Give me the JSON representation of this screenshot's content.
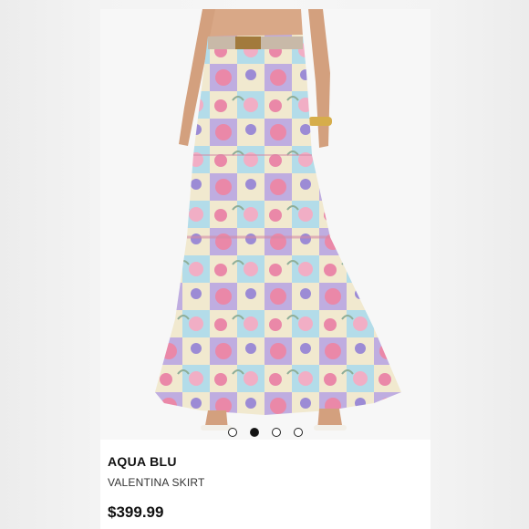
{
  "product": {
    "brand": "AQUA BLU",
    "name": "VALENTINA SKIRT",
    "price": "$399.99"
  },
  "carousel": {
    "total": 4,
    "active_index": 1
  },
  "colors": {
    "price": "#111111",
    "pink": "#e8789c",
    "lilac": "#b7a2dc",
    "aqua": "#a9d8e6",
    "cream": "#efe6c9"
  }
}
